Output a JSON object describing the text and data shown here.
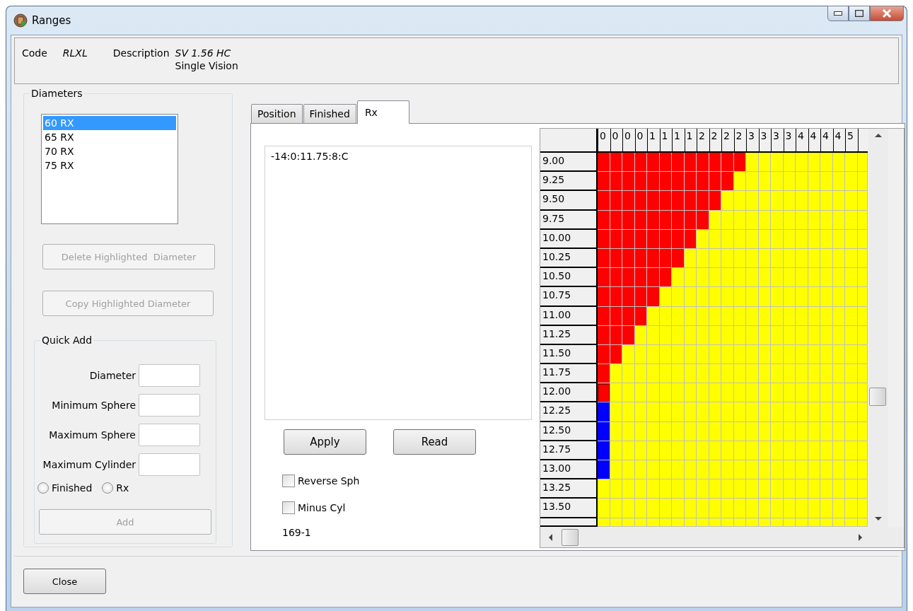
{
  "window": {
    "title": "Ranges"
  },
  "header": {
    "code_label": "Code",
    "code": "RLXL",
    "description_label": "Description",
    "description": "SV 1.56 HC",
    "description_line2": "Single Vision"
  },
  "diameters": {
    "title": "Diameters",
    "items": [
      {
        "label": "60 RX",
        "selected": true
      },
      {
        "label": "65 RX",
        "selected": false
      },
      {
        "label": "70 RX",
        "selected": false
      },
      {
        "label": "75 RX",
        "selected": false
      }
    ],
    "buttons": [
      {
        "label": "Delete Highlighted  Diameter",
        "disabled": true
      },
      {
        "label": "Copy Highlighted Diameter",
        "disabled": true
      }
    ],
    "quick_add": {
      "title": "Quick Add",
      "fields": [
        {
          "label": "Diameter"
        },
        {
          "label": "Minimum Sphere"
        },
        {
          "label": "Maximum Sphere"
        },
        {
          "label": "Maximum Cylinder"
        }
      ],
      "radios": [
        {
          "label": "Finished",
          "selected": false
        },
        {
          "label": "Rx",
          "selected": false
        }
      ],
      "button": {
        "label": "Add",
        "disabled": true
      }
    }
  },
  "tabs": [
    {
      "label": "Position",
      "selected": false
    },
    {
      "label": "Finished",
      "selected": false
    },
    {
      "label": "Rx",
      "selected": true
    }
  ],
  "rx": {
    "text": "-14:0:11.75:8:C",
    "buttons": [
      "Apply",
      "Read"
    ],
    "checkboxes": [
      {
        "label": "Reverse Sph",
        "checked": false
      },
      {
        "label": "Minus Cyl",
        "checked": false
      }
    ],
    "status": "169-1"
  },
  "grid": {
    "columns": [
      "0",
      "0",
      "0",
      "0",
      "1",
      "1",
      "1",
      "1",
      "2",
      "2",
      "2",
      "2",
      "3",
      "3",
      "3",
      "3",
      "4",
      "4",
      "4",
      "4",
      "5"
    ],
    "rows": [
      {
        "label": "9.00",
        "cells": [
          {
            "color": "#ff0000"
          },
          {
            "color": "#ff0000"
          },
          {
            "color": "#ff0000"
          },
          {
            "color": "#ff0000"
          },
          {
            "color": "#ff0000"
          },
          {
            "color": "#ff0000"
          },
          {
            "color": "#ff0000"
          },
          {
            "color": "#ff0000"
          },
          {
            "color": "#ff0000"
          },
          {
            "color": "#ff0000"
          },
          {
            "color": "#ff0000"
          },
          {
            "color": "#ff0000"
          },
          {
            "color": "#ffff00"
          },
          {
            "color": "#ffff00"
          },
          {
            "color": "#ffff00"
          },
          {
            "color": "#ffff00"
          },
          {
            "color": "#ffff00"
          },
          {
            "color": "#ffff00"
          },
          {
            "color": "#ffff00"
          },
          {
            "color": "#ffff00"
          },
          {
            "color": "#ffff00"
          },
          {
            "color": "#ffff00"
          }
        ]
      },
      {
        "label": "9.25",
        "cells": [
          {
            "color": "#ff0000"
          },
          {
            "color": "#ff0000"
          },
          {
            "color": "#ff0000"
          },
          {
            "color": "#ff0000"
          },
          {
            "color": "#ff0000"
          },
          {
            "color": "#ff0000"
          },
          {
            "color": "#ff0000"
          },
          {
            "color": "#ff0000"
          },
          {
            "color": "#ff0000"
          },
          {
            "color": "#ff0000"
          },
          {
            "color": "#ff0000"
          },
          {
            "color": "#ffff00"
          },
          {
            "color": "#ffff00"
          },
          {
            "color": "#ffff00"
          },
          {
            "color": "#ffff00"
          },
          {
            "color": "#ffff00"
          },
          {
            "color": "#ffff00"
          },
          {
            "color": "#ffff00"
          },
          {
            "color": "#ffff00"
          },
          {
            "color": "#ffff00"
          },
          {
            "color": "#ffff00"
          },
          {
            "color": "#ffff00"
          }
        ]
      },
      {
        "label": "9.50",
        "cells": [
          {
            "color": "#ff0000"
          },
          {
            "color": "#ff0000"
          },
          {
            "color": "#ff0000"
          },
          {
            "color": "#ff0000"
          },
          {
            "color": "#ff0000"
          },
          {
            "color": "#ff0000"
          },
          {
            "color": "#ff0000"
          },
          {
            "color": "#ff0000"
          },
          {
            "color": "#ff0000"
          },
          {
            "color": "#ff0000"
          },
          {
            "color": "#ffff00"
          },
          {
            "color": "#ffff00"
          },
          {
            "color": "#ffff00"
          },
          {
            "color": "#ffff00"
          },
          {
            "color": "#ffff00"
          },
          {
            "color": "#ffff00"
          },
          {
            "color": "#ffff00"
          },
          {
            "color": "#ffff00"
          },
          {
            "color": "#ffff00"
          },
          {
            "color": "#ffff00"
          },
          {
            "color": "#ffff00"
          },
          {
            "color": "#ffff00"
          }
        ]
      },
      {
        "label": "9.75",
        "cells": [
          {
            "color": "#ff0000"
          },
          {
            "color": "#ff0000"
          },
          {
            "color": "#ff0000"
          },
          {
            "color": "#ff0000"
          },
          {
            "color": "#ff0000"
          },
          {
            "color": "#ff0000"
          },
          {
            "color": "#ff0000"
          },
          {
            "color": "#ff0000"
          },
          {
            "color": "#ff0000"
          },
          {
            "color": "#ffff00"
          },
          {
            "color": "#ffff00"
          },
          {
            "color": "#ffff00"
          },
          {
            "color": "#ffff00"
          },
          {
            "color": "#ffff00"
          },
          {
            "color": "#ffff00"
          },
          {
            "color": "#ffff00"
          },
          {
            "color": "#ffff00"
          },
          {
            "color": "#ffff00"
          },
          {
            "color": "#ffff00"
          },
          {
            "color": "#ffff00"
          },
          {
            "color": "#ffff00"
          },
          {
            "color": "#ffff00"
          }
        ]
      },
      {
        "label": "10.00",
        "cells": [
          {
            "color": "#ff0000"
          },
          {
            "color": "#ff0000"
          },
          {
            "color": "#ff0000"
          },
          {
            "color": "#ff0000"
          },
          {
            "color": "#ff0000"
          },
          {
            "color": "#ff0000"
          },
          {
            "color": "#ff0000"
          },
          {
            "color": "#ff0000"
          },
          {
            "color": "#ffff00"
          },
          {
            "color": "#ffff00"
          },
          {
            "color": "#ffff00"
          },
          {
            "color": "#ffff00"
          },
          {
            "color": "#ffff00"
          },
          {
            "color": "#ffff00"
          },
          {
            "color": "#ffff00"
          },
          {
            "color": "#ffff00"
          },
          {
            "color": "#ffff00"
          },
          {
            "color": "#ffff00"
          },
          {
            "color": "#ffff00"
          },
          {
            "color": "#ffff00"
          },
          {
            "color": "#ffff00"
          },
          {
            "color": "#ffff00"
          }
        ]
      },
      {
        "label": "10.25",
        "cells": [
          {
            "color": "#ff0000"
          },
          {
            "color": "#ff0000"
          },
          {
            "color": "#ff0000"
          },
          {
            "color": "#ff0000"
          },
          {
            "color": "#ff0000"
          },
          {
            "color": "#ff0000"
          },
          {
            "color": "#ff0000"
          },
          {
            "color": "#ffff00"
          },
          {
            "color": "#ffff00"
          },
          {
            "color": "#ffff00"
          },
          {
            "color": "#ffff00"
          },
          {
            "color": "#ffff00"
          },
          {
            "color": "#ffff00"
          },
          {
            "color": "#ffff00"
          },
          {
            "color": "#ffff00"
          },
          {
            "color": "#ffff00"
          },
          {
            "color": "#ffff00"
          },
          {
            "color": "#ffff00"
          },
          {
            "color": "#ffff00"
          },
          {
            "color": "#ffff00"
          },
          {
            "color": "#ffff00"
          },
          {
            "color": "#ffff00"
          }
        ]
      },
      {
        "label": "10.50",
        "cells": [
          {
            "color": "#ff0000"
          },
          {
            "color": "#ff0000"
          },
          {
            "color": "#ff0000"
          },
          {
            "color": "#ff0000"
          },
          {
            "color": "#ff0000"
          },
          {
            "color": "#ff0000"
          },
          {
            "color": "#ffff00"
          },
          {
            "color": "#ffff00"
          },
          {
            "color": "#ffff00"
          },
          {
            "color": "#ffff00"
          },
          {
            "color": "#ffff00"
          },
          {
            "color": "#ffff00"
          },
          {
            "color": "#ffff00"
          },
          {
            "color": "#ffff00"
          },
          {
            "color": "#ffff00"
          },
          {
            "color": "#ffff00"
          },
          {
            "color": "#ffff00"
          },
          {
            "color": "#ffff00"
          },
          {
            "color": "#ffff00"
          },
          {
            "color": "#ffff00"
          },
          {
            "color": "#ffff00"
          },
          {
            "color": "#ffff00"
          }
        ]
      },
      {
        "label": "10.75",
        "cells": [
          {
            "color": "#ff0000"
          },
          {
            "color": "#ff0000"
          },
          {
            "color": "#ff0000"
          },
          {
            "color": "#ff0000"
          },
          {
            "color": "#ff0000"
          },
          {
            "color": "#ffff00"
          },
          {
            "color": "#ffff00"
          },
          {
            "color": "#ffff00"
          },
          {
            "color": "#ffff00"
          },
          {
            "color": "#ffff00"
          },
          {
            "color": "#ffff00"
          },
          {
            "color": "#ffff00"
          },
          {
            "color": "#ffff00"
          },
          {
            "color": "#ffff00"
          },
          {
            "color": "#ffff00"
          },
          {
            "color": "#ffff00"
          },
          {
            "color": "#ffff00"
          },
          {
            "color": "#ffff00"
          },
          {
            "color": "#ffff00"
          },
          {
            "color": "#ffff00"
          },
          {
            "color": "#ffff00"
          },
          {
            "color": "#ffff00"
          }
        ]
      },
      {
        "label": "11.00",
        "cells": [
          {
            "color": "#ff0000"
          },
          {
            "color": "#ff0000"
          },
          {
            "color": "#ff0000"
          },
          {
            "color": "#ff0000"
          },
          {
            "color": "#ffff00"
          },
          {
            "color": "#ffff00"
          },
          {
            "color": "#ffff00"
          },
          {
            "color": "#ffff00"
          },
          {
            "color": "#ffff00"
          },
          {
            "color": "#ffff00"
          },
          {
            "color": "#ffff00"
          },
          {
            "color": "#ffff00"
          },
          {
            "color": "#ffff00"
          },
          {
            "color": "#ffff00"
          },
          {
            "color": "#ffff00"
          },
          {
            "color": "#ffff00"
          },
          {
            "color": "#ffff00"
          },
          {
            "color": "#ffff00"
          },
          {
            "color": "#ffff00"
          },
          {
            "color": "#ffff00"
          },
          {
            "color": "#ffff00"
          },
          {
            "color": "#ffff00"
          }
        ]
      },
      {
        "label": "11.25",
        "cells": [
          {
            "color": "#ff0000"
          },
          {
            "color": "#ff0000"
          },
          {
            "color": "#ff0000"
          },
          {
            "color": "#ffff00"
          },
          {
            "color": "#ffff00"
          },
          {
            "color": "#ffff00"
          },
          {
            "color": "#ffff00"
          },
          {
            "color": "#ffff00"
          },
          {
            "color": "#ffff00"
          },
          {
            "color": "#ffff00"
          },
          {
            "color": "#ffff00"
          },
          {
            "color": "#ffff00"
          },
          {
            "color": "#ffff00"
          },
          {
            "color": "#ffff00"
          },
          {
            "color": "#ffff00"
          },
          {
            "color": "#ffff00"
          },
          {
            "color": "#ffff00"
          },
          {
            "color": "#ffff00"
          },
          {
            "color": "#ffff00"
          },
          {
            "color": "#ffff00"
          },
          {
            "color": "#ffff00"
          },
          {
            "color": "#ffff00"
          }
        ]
      },
      {
        "label": "11.50",
        "cells": [
          {
            "color": "#ff0000"
          },
          {
            "color": "#ff0000"
          },
          {
            "color": "#ffff00"
          },
          {
            "color": "#ffff00"
          },
          {
            "color": "#ffff00"
          },
          {
            "color": "#ffff00"
          },
          {
            "color": "#ffff00"
          },
          {
            "color": "#ffff00"
          },
          {
            "color": "#ffff00"
          },
          {
            "color": "#ffff00"
          },
          {
            "color": "#ffff00"
          },
          {
            "color": "#ffff00"
          },
          {
            "color": "#ffff00"
          },
          {
            "color": "#ffff00"
          },
          {
            "color": "#ffff00"
          },
          {
            "color": "#ffff00"
          },
          {
            "color": "#ffff00"
          },
          {
            "color": "#ffff00"
          },
          {
            "color": "#ffff00"
          },
          {
            "color": "#ffff00"
          },
          {
            "color": "#ffff00"
          },
          {
            "color": "#ffff00"
          }
        ]
      },
      {
        "label": "11.75",
        "cells": [
          {
            "color": "#ff0000"
          },
          {
            "color": "#ffff00"
          },
          {
            "color": "#ffff00"
          },
          {
            "color": "#ffff00"
          },
          {
            "color": "#ffff00"
          },
          {
            "color": "#ffff00"
          },
          {
            "color": "#ffff00"
          },
          {
            "color": "#ffff00"
          },
          {
            "color": "#ffff00"
          },
          {
            "color": "#ffff00"
          },
          {
            "color": "#ffff00"
          },
          {
            "color": "#ffff00"
          },
          {
            "color": "#ffff00"
          },
          {
            "color": "#ffff00"
          },
          {
            "color": "#ffff00"
          },
          {
            "color": "#ffff00"
          },
          {
            "color": "#ffff00"
          },
          {
            "color": "#ffff00"
          },
          {
            "color": "#ffff00"
          },
          {
            "color": "#ffff00"
          },
          {
            "color": "#ffff00"
          },
          {
            "color": "#ffff00"
          }
        ]
      },
      {
        "label": "12.00",
        "cells": [
          {
            "color": "#ff0000",
            "focused": true
          },
          {
            "color": "#ffff00"
          },
          {
            "color": "#ffff00"
          },
          {
            "color": "#ffff00"
          },
          {
            "color": "#ffff00"
          },
          {
            "color": "#ffff00"
          },
          {
            "color": "#ffff00"
          },
          {
            "color": "#ffff00"
          },
          {
            "color": "#ffff00"
          },
          {
            "color": "#ffff00"
          },
          {
            "color": "#ffff00"
          },
          {
            "color": "#ffff00"
          },
          {
            "color": "#ffff00"
          },
          {
            "color": "#ffff00"
          },
          {
            "color": "#ffff00"
          },
          {
            "color": "#ffff00"
          },
          {
            "color": "#ffff00"
          },
          {
            "color": "#ffff00"
          },
          {
            "color": "#ffff00"
          },
          {
            "color": "#ffff00"
          },
          {
            "color": "#ffff00"
          },
          {
            "color": "#ffff00"
          }
        ]
      },
      {
        "label": "12.25",
        "cells": [
          {
            "color": "#0000ff"
          },
          {
            "color": "#ffff00"
          },
          {
            "color": "#ffff00"
          },
          {
            "color": "#ffff00"
          },
          {
            "color": "#ffff00"
          },
          {
            "color": "#ffff00"
          },
          {
            "color": "#ffff00"
          },
          {
            "color": "#ffff00"
          },
          {
            "color": "#ffff00"
          },
          {
            "color": "#ffff00"
          },
          {
            "color": "#ffff00"
          },
          {
            "color": "#ffff00"
          },
          {
            "color": "#ffff00"
          },
          {
            "color": "#ffff00"
          },
          {
            "color": "#ffff00"
          },
          {
            "color": "#ffff00"
          },
          {
            "color": "#ffff00"
          },
          {
            "color": "#ffff00"
          },
          {
            "color": "#ffff00"
          },
          {
            "color": "#ffff00"
          },
          {
            "color": "#ffff00"
          },
          {
            "color": "#ffff00"
          }
        ]
      },
      {
        "label": "12.50",
        "cells": [
          {
            "color": "#0000ff"
          },
          {
            "color": "#ffff00"
          },
          {
            "color": "#ffff00"
          },
          {
            "color": "#ffff00"
          },
          {
            "color": "#ffff00"
          },
          {
            "color": "#ffff00"
          },
          {
            "color": "#ffff00"
          },
          {
            "color": "#ffff00"
          },
          {
            "color": "#ffff00"
          },
          {
            "color": "#ffff00"
          },
          {
            "color": "#ffff00"
          },
          {
            "color": "#ffff00"
          },
          {
            "color": "#ffff00"
          },
          {
            "color": "#ffff00"
          },
          {
            "color": "#ffff00"
          },
          {
            "color": "#ffff00"
          },
          {
            "color": "#ffff00"
          },
          {
            "color": "#ffff00"
          },
          {
            "color": "#ffff00"
          },
          {
            "color": "#ffff00"
          },
          {
            "color": "#ffff00"
          },
          {
            "color": "#ffff00"
          }
        ]
      },
      {
        "label": "12.75",
        "cells": [
          {
            "color": "#0000ff"
          },
          {
            "color": "#ffff00"
          },
          {
            "color": "#ffff00"
          },
          {
            "color": "#ffff00"
          },
          {
            "color": "#ffff00"
          },
          {
            "color": "#ffff00"
          },
          {
            "color": "#ffff00"
          },
          {
            "color": "#ffff00"
          },
          {
            "color": "#ffff00"
          },
          {
            "color": "#ffff00"
          },
          {
            "color": "#ffff00"
          },
          {
            "color": "#ffff00"
          },
          {
            "color": "#ffff00"
          },
          {
            "color": "#ffff00"
          },
          {
            "color": "#ffff00"
          },
          {
            "color": "#ffff00"
          },
          {
            "color": "#ffff00"
          },
          {
            "color": "#ffff00"
          },
          {
            "color": "#ffff00"
          },
          {
            "color": "#ffff00"
          },
          {
            "color": "#ffff00"
          },
          {
            "color": "#ffff00"
          }
        ]
      },
      {
        "label": "13.00",
        "cells": [
          {
            "color": "#0000ff"
          },
          {
            "color": "#ffff00"
          },
          {
            "color": "#ffff00"
          },
          {
            "color": "#ffff00"
          },
          {
            "color": "#ffff00"
          },
          {
            "color": "#ffff00"
          },
          {
            "color": "#ffff00"
          },
          {
            "color": "#ffff00"
          },
          {
            "color": "#ffff00"
          },
          {
            "color": "#ffff00"
          },
          {
            "color": "#ffff00"
          },
          {
            "color": "#ffff00"
          },
          {
            "color": "#ffff00"
          },
          {
            "color": "#ffff00"
          },
          {
            "color": "#ffff00"
          },
          {
            "color": "#ffff00"
          },
          {
            "color": "#ffff00"
          },
          {
            "color": "#ffff00"
          },
          {
            "color": "#ffff00"
          },
          {
            "color": "#ffff00"
          },
          {
            "color": "#ffff00"
          },
          {
            "color": "#ffff00"
          }
        ]
      },
      {
        "label": "13.25",
        "cells": [
          {
            "color": "#ffff00"
          },
          {
            "color": "#ffff00"
          },
          {
            "color": "#ffff00"
          },
          {
            "color": "#ffff00"
          },
          {
            "color": "#ffff00"
          },
          {
            "color": "#ffff00"
          },
          {
            "color": "#ffff00"
          },
          {
            "color": "#ffff00"
          },
          {
            "color": "#ffff00"
          },
          {
            "color": "#ffff00"
          },
          {
            "color": "#ffff00"
          },
          {
            "color": "#ffff00"
          },
          {
            "color": "#ffff00"
          },
          {
            "color": "#ffff00"
          },
          {
            "color": "#ffff00"
          },
          {
            "color": "#ffff00"
          },
          {
            "color": "#ffff00"
          },
          {
            "color": "#ffff00"
          },
          {
            "color": "#ffff00"
          },
          {
            "color": "#ffff00"
          },
          {
            "color": "#ffff00"
          },
          {
            "color": "#ffff00"
          }
        ]
      },
      {
        "label": "13.50",
        "cells": [
          {
            "color": "#ffff00"
          },
          {
            "color": "#ffff00"
          },
          {
            "color": "#ffff00"
          },
          {
            "color": "#ffff00"
          },
          {
            "color": "#ffff00"
          },
          {
            "color": "#ffff00"
          },
          {
            "color": "#ffff00"
          },
          {
            "color": "#ffff00"
          },
          {
            "color": "#ffff00"
          },
          {
            "color": "#ffff00"
          },
          {
            "color": "#ffff00"
          },
          {
            "color": "#ffff00"
          },
          {
            "color": "#ffff00"
          },
          {
            "color": "#ffff00"
          },
          {
            "color": "#ffff00"
          },
          {
            "color": "#ffff00"
          },
          {
            "color": "#ffff00"
          },
          {
            "color": "#ffff00"
          },
          {
            "color": "#ffff00"
          },
          {
            "color": "#ffff00"
          },
          {
            "color": "#ffff00"
          },
          {
            "color": "#ffff00"
          }
        ]
      },
      {
        "cells": [
          {
            "color": "#ffff00"
          },
          {
            "color": "#ffff00"
          },
          {
            "color": "#ffff00"
          },
          {
            "color": "#ffff00"
          },
          {
            "color": "#ffff00"
          },
          {
            "color": "#ffff00"
          },
          {
            "color": "#ffff00"
          },
          {
            "color": "#ffff00"
          },
          {
            "color": "#ffff00"
          },
          {
            "color": "#ffff00"
          },
          {
            "color": "#ffff00"
          },
          {
            "color": "#ffff00"
          },
          {
            "color": "#ffff00"
          },
          {
            "color": "#ffff00"
          },
          {
            "color": "#ffff00"
          },
          {
            "color": "#ffff00"
          },
          {
            "color": "#ffff00"
          },
          {
            "color": "#ffff00"
          },
          {
            "color": "#ffff00"
          },
          {
            "color": "#ffff00"
          },
          {
            "color": "#ffff00"
          },
          {
            "color": "#ffff00"
          }
        ]
      }
    ]
  },
  "footer": {
    "button": "Close"
  }
}
